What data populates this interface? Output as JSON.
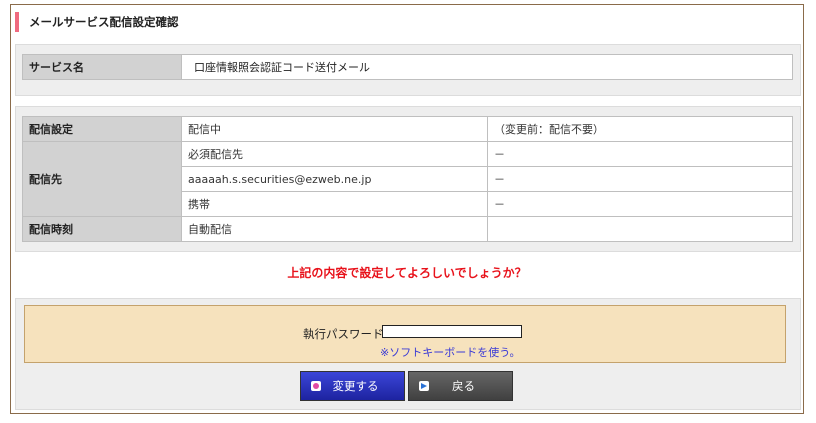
{
  "page": {
    "title": "メールサービス配信設定確認"
  },
  "service": {
    "label": "サービス名",
    "value": "口座情報照会認証コード送付メール"
  },
  "settings": {
    "delivery_setting": {
      "label": "配信設定",
      "value": "配信中",
      "previous": "（変更前：配信不要）"
    },
    "destination": {
      "label": "配信先",
      "rows": [
        {
          "value": "必須配信先",
          "note": "－"
        },
        {
          "value": "aaaaah.s.securities@ezweb.ne.jp",
          "note": "－"
        },
        {
          "value": "携帯",
          "note": "－"
        }
      ]
    },
    "delivery_time": {
      "label": "配信時刻",
      "value": "自動配信",
      "note": ""
    }
  },
  "confirm": {
    "message": "上記の内容で設定してよろしいでしょうか？"
  },
  "password": {
    "label": "執行パスワード",
    "value": "",
    "soft_keyboard_link": "※ソフトキーボードを使う。"
  },
  "buttons": {
    "change_label": "変更する",
    "back_label": "戻る"
  },
  "colors": {
    "accent": "#f06a7f",
    "confirm_text": "#e8121b",
    "link": "#3b3bd6",
    "change_button": "#2b33c2",
    "back_button": "#505050"
  },
  "icons": {
    "change": "pink-dot-icon",
    "back": "blue-arrow-icon"
  }
}
